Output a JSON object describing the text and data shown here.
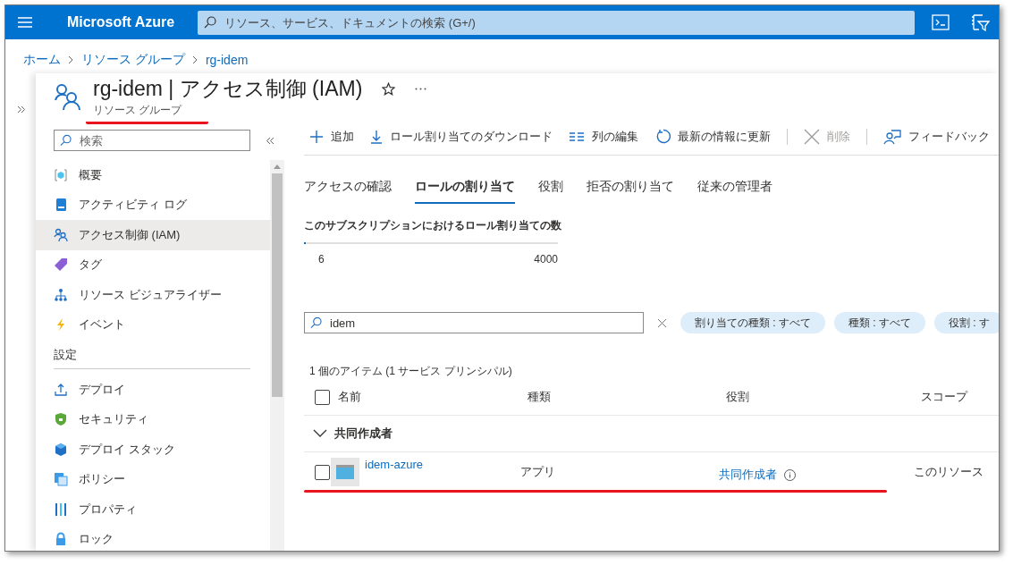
{
  "topbar": {
    "brand": "Microsoft Azure",
    "search": {
      "placeholder": "リソース、サービス、ドキュメントの検索 (G+/)"
    }
  },
  "breadcrumb": [
    "ホーム",
    "リソース グループ",
    "rg-idem"
  ],
  "header": {
    "title": "rg-idem | アクセス制御 (IAM)",
    "subtitle": "リソース グループ",
    "subtitle_underlined": true
  },
  "sidebar": {
    "search": {
      "placeholder": "検索"
    },
    "groups": [
      {
        "items": [
          {
            "label": "概要",
            "selected": false
          },
          {
            "label": "アクティビティ ログ",
            "selected": false
          },
          {
            "label": "アクセス制御 (IAM)",
            "selected": true
          },
          {
            "label": "タグ",
            "selected": false
          },
          {
            "label": "リソース ビジュアライザー",
            "selected": false
          },
          {
            "label": "イベント",
            "selected": false
          }
        ]
      },
      {
        "title": "設定",
        "items": [
          {
            "label": "デプロイ",
            "selected": false
          },
          {
            "label": "セキュリティ",
            "selected": false
          },
          {
            "label": "デプロイ スタック",
            "selected": false
          },
          {
            "label": "ポリシー",
            "selected": false
          },
          {
            "label": "プロパティ",
            "selected": false
          },
          {
            "label": "ロック",
            "selected": false
          }
        ]
      }
    ]
  },
  "toolbar": [
    {
      "kind": "button",
      "label": "追加",
      "disabled": false
    },
    {
      "kind": "button",
      "label": "ロール割り当てのダウンロード",
      "disabled": false
    },
    {
      "kind": "button",
      "label": "列の編集",
      "disabled": false
    },
    {
      "kind": "button",
      "label": "最新の情報に更新",
      "disabled": false
    },
    {
      "kind": "separator"
    },
    {
      "kind": "button",
      "label": "削除",
      "disabled": true
    },
    {
      "kind": "separator"
    },
    {
      "kind": "button",
      "label": "フィードバック",
      "disabled": false
    }
  ],
  "tabs": [
    {
      "label": "アクセスの確認",
      "selected": false
    },
    {
      "label": "ロールの割り当て",
      "selected": true
    },
    {
      "label": "役割",
      "selected": false
    },
    {
      "label": "拒否の割り当て",
      "selected": false
    },
    {
      "label": "従来の管理者",
      "selected": false
    }
  ],
  "meter": {
    "label": "このサブスクリプションにおけるロール割り当ての数",
    "level": 0.0015,
    "value": "6",
    "max": "4000"
  },
  "filter": {
    "value": "idem",
    "pills": [
      "割り当ての種類 : すべて",
      "種類 : すべて",
      "役割 : す"
    ]
  },
  "count": "1 個のアイテム (1 サービス プリンシパル)",
  "table": {
    "all_checked": false,
    "columns": [
      "名前",
      "種類",
      "役割",
      "スコープ"
    ],
    "groups": [
      {
        "title": "共同作成者",
        "expanded": true,
        "rows": [
          {
            "name": "idem-azure",
            "type": "アプリ",
            "role": "共同作成者",
            "scope": "このリソース",
            "checked": false,
            "underlined": true
          }
        ]
      }
    ]
  }
}
